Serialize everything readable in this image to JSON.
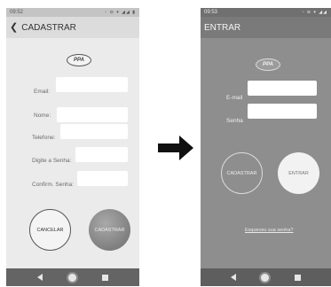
{
  "cadastro": {
    "status_time": "09:52",
    "status_icons": "▫ ⊖ ▾ ◢◢ ▮",
    "title": "CADASTRAR",
    "logo_text": "PPA",
    "fields": [
      {
        "label": "Email:",
        "value": ""
      },
      {
        "label": "Nome:",
        "value": ""
      },
      {
        "label": "Telefone:",
        "value": ""
      },
      {
        "label": "Digite a Senha:",
        "value": ""
      },
      {
        "label": "Confirm. Senha:",
        "value": ""
      }
    ],
    "cancel_label": "CANCELAR",
    "submit_label": "CADASTRAR"
  },
  "entrar": {
    "status_time": "09:53",
    "status_icons": "▫ ⊖ ▾ ◢◢",
    "title": "ENTRAR",
    "logo_text": "PPA",
    "fields": [
      {
        "label": "E-mail",
        "value": ""
      },
      {
        "label": "Senha",
        "value": ""
      }
    ],
    "register_label": "CADASTRAR",
    "login_label": "ENTRAR",
    "forgot_label": "Esqueceu sua senha?"
  },
  "icons": {
    "back": "arrow-left-icon",
    "transition": "arrow-right-icon",
    "nav_back": "nav-back-icon",
    "nav_home": "nav-home-icon",
    "nav_recent": "nav-recent-icon"
  }
}
